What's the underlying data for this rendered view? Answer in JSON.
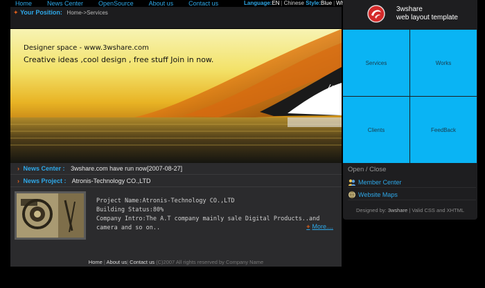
{
  "nav": {
    "items": [
      "Home",
      "News Center",
      "OpenSource",
      "About us",
      "Contact us"
    ]
  },
  "lang": {
    "language_label": "Language:",
    "language_value": "EN",
    "style_lang": "Chinese",
    "style_label": "Style:",
    "style_blue": "Blue",
    "style_white": "White"
  },
  "position": {
    "label": "Your Position:",
    "crumb": "Home->Services"
  },
  "banner": {
    "line1": "Designer space - www.3wshare.com",
    "line2": "Creative ideas ,cool design , free stuff Join in now."
  },
  "news": {
    "center_label": "News Center :",
    "center_value": "3wshare.com have run now[2007-08-27]",
    "project_label": "News Project :",
    "project_value": "Atronis-Technology CO.,LTD"
  },
  "project": {
    "name": "Project Name:Atronis-Technology CO.,LTD",
    "status": "Building Status:80%",
    "intro": "Company Intro:The A.T company mainly sale Digital Products..and camera and so on..",
    "more": "More...."
  },
  "footer": {
    "home": "Home",
    "about": "About us",
    "contact": "Contact us",
    "copyright": "(C)2007 All rights reserved by Company Name"
  },
  "side": {
    "logo_line1": "3wshare",
    "logo_line2": "web layout template",
    "tiles": [
      "Services",
      "Works",
      "Clients",
      "FeedBack"
    ],
    "open_close": "Open / Close",
    "member_center": "Member Center",
    "website_maps": "Website Maps",
    "designed_by": "Designed by:",
    "designed_brand": "3wshare",
    "valid": "| Valid CSS and XHTML"
  },
  "colors": {
    "accent_blue": "#2ea8e8",
    "tile_blue": "#0ab4f4",
    "arrow_orange": "#e0601c",
    "logo_red": "#d42a2a"
  }
}
